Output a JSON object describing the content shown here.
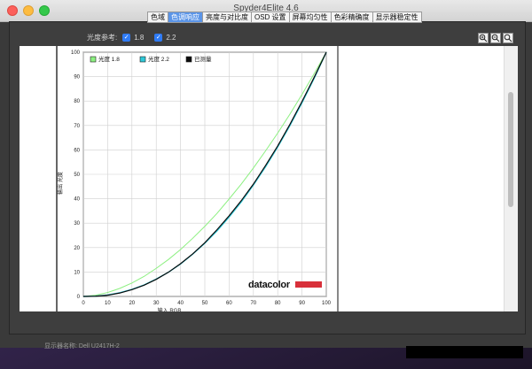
{
  "window": {
    "title": "Spyder4Elite 4.6"
  },
  "tabs": [
    {
      "label": "色域",
      "active": false
    },
    {
      "label": "色调响应",
      "active": true
    },
    {
      "label": "亮度与对比度",
      "active": false
    },
    {
      "label": "OSD 设置",
      "active": false
    },
    {
      "label": "屏幕均匀性",
      "active": false
    },
    {
      "label": "色彩精确度",
      "active": false
    },
    {
      "label": "显示器稳定性",
      "active": false
    }
  ],
  "reference": {
    "label": "光度参考:",
    "options": [
      {
        "label": "1.8",
        "checked": true
      },
      {
        "label": "2.2",
        "checked": true
      }
    ]
  },
  "zoom": {
    "in_icon": "zoom-in-icon",
    "out_icon": "zoom-out-icon",
    "fit_icon": "zoom-fit-icon"
  },
  "status": {
    "display_name": "显示器名称: Dell U2417H-2"
  },
  "colors": {
    "gamma18": "#8cf080",
    "gamma22": "#2ec8d8",
    "measured": "#0a0a0a",
    "brand_bar": "#d8303a"
  },
  "brand": {
    "name": "datacolor"
  },
  "chart_data": {
    "type": "line",
    "xlabel": "输入 RGB",
    "ylabel": "输出 光度",
    "xlim": [
      0,
      100
    ],
    "ylim": [
      0,
      100
    ],
    "xticks": [
      "0",
      "10",
      "20",
      "30",
      "40",
      "50",
      "60",
      "70",
      "80",
      "90",
      "100"
    ],
    "yticks": [
      "0",
      "10",
      "20",
      "30",
      "40",
      "50",
      "60",
      "70",
      "80",
      "90",
      "100"
    ],
    "grid": true,
    "legend_position": "top-left",
    "series": [
      {
        "name": "光度 1.8",
        "color": "#8cf080",
        "x": [
          0,
          5,
          10,
          15,
          20,
          25,
          30,
          35,
          40,
          45,
          50,
          55,
          60,
          65,
          70,
          75,
          80,
          85,
          90,
          95,
          100
        ],
        "y": [
          0,
          0.5,
          1.6,
          3.3,
          5.5,
          8.2,
          11.5,
          15.1,
          19.2,
          23.8,
          28.7,
          34.0,
          39.9,
          46.0,
          52.6,
          59.6,
          66.9,
          74.6,
          82.7,
          91.2,
          100
        ]
      },
      {
        "name": "光度 2.2",
        "color": "#2ec8d8",
        "x": [
          0,
          5,
          10,
          15,
          20,
          25,
          30,
          35,
          40,
          45,
          50,
          55,
          60,
          65,
          70,
          75,
          80,
          85,
          90,
          95,
          100
        ],
        "y": [
          0,
          0.1,
          0.6,
          1.5,
          2.9,
          4.7,
          7.1,
          9.9,
          13.3,
          17.3,
          21.8,
          26.8,
          32.5,
          38.7,
          45.6,
          53.1,
          61.2,
          69.9,
          79.3,
          89.3,
          100
        ]
      },
      {
        "name": "已测量",
        "color": "#0a0a0a",
        "x": [
          0,
          5,
          10,
          15,
          20,
          25,
          30,
          35,
          40,
          45,
          50,
          55,
          60,
          65,
          70,
          75,
          80,
          85,
          90,
          95,
          100
        ],
        "y": [
          0,
          0.1,
          0.5,
          1.4,
          2.8,
          4.6,
          7.0,
          9.9,
          13.4,
          17.4,
          22.0,
          27.3,
          33.0,
          39.2,
          46.0,
          53.6,
          61.6,
          70.4,
          79.8,
          89.7,
          100
        ]
      }
    ]
  }
}
